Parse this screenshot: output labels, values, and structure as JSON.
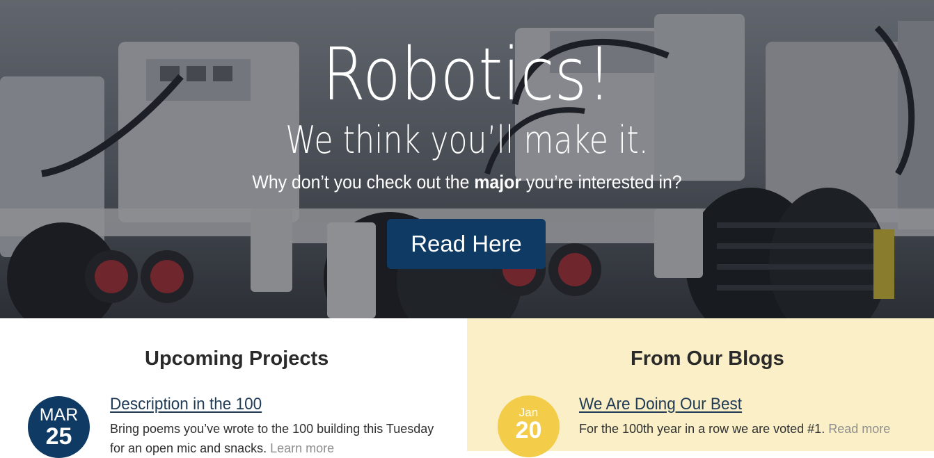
{
  "hero": {
    "title": "Robotics!",
    "subtitle": "We think you’ll make it.",
    "prompt_before": "Why don’t you check out the ",
    "prompt_bold": "major",
    "prompt_after": " you’re interested in?",
    "button_label": "Read Here"
  },
  "colors": {
    "accent_navy": "#0e3a63",
    "accent_gold": "#f3cc4a",
    "blog_background": "#faefc6"
  },
  "projects": {
    "heading": "Upcoming Projects",
    "item": {
      "month": "MAR",
      "day": "25",
      "title": "Description in the 100",
      "text": "Bring poems you’ve wrote to the 100 building this Tuesday for an open mic and snacks.",
      "link_label": "Learn more"
    }
  },
  "blogs": {
    "heading": "From Our Blogs",
    "item": {
      "month": "Jan",
      "day": "20",
      "title": "We Are Doing Our Best",
      "text": "For the 100th year in a row we are voted #1.",
      "link_label": "Read more"
    }
  }
}
